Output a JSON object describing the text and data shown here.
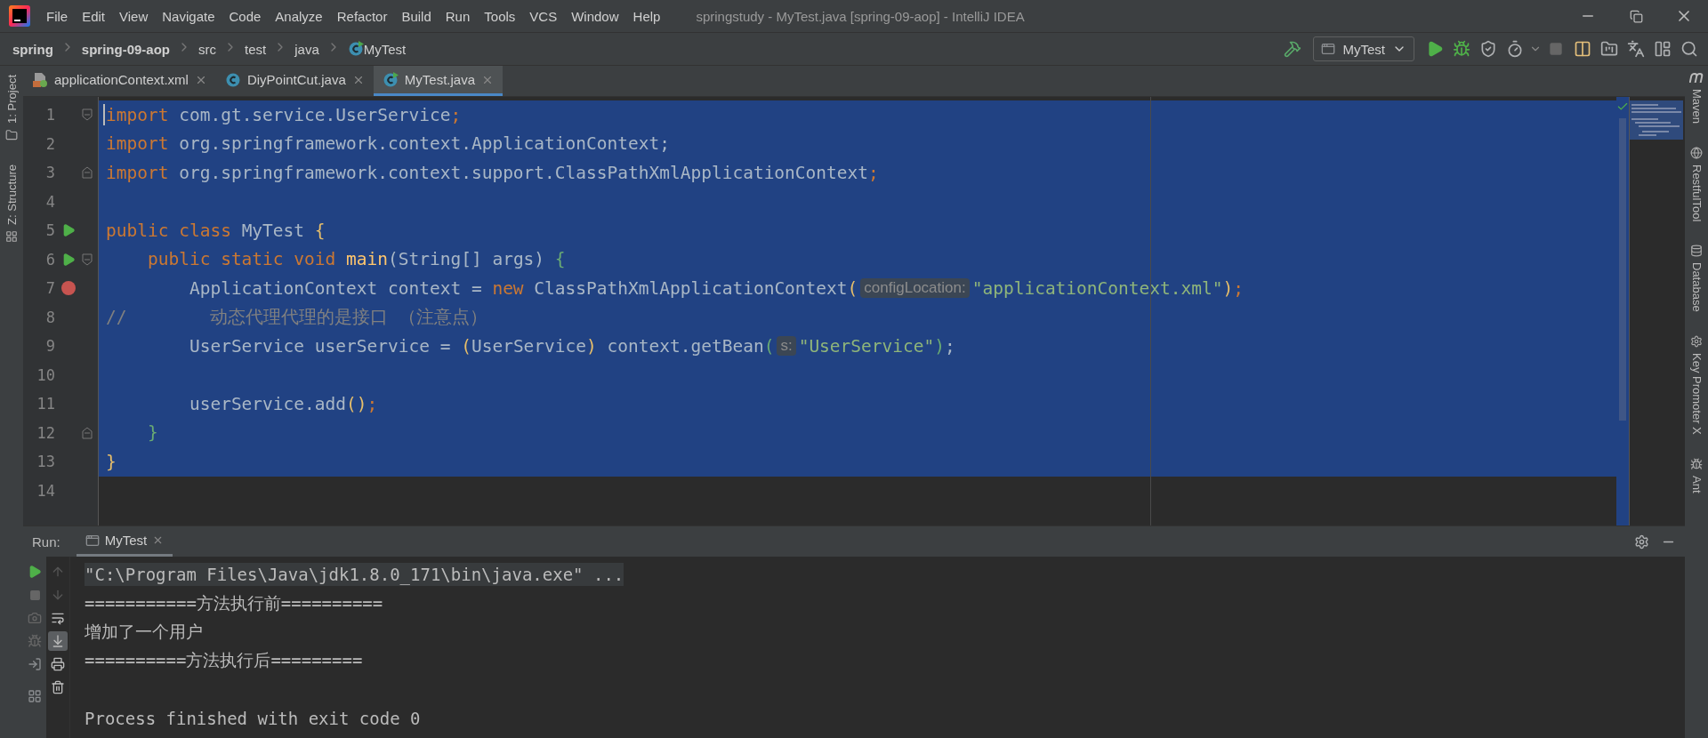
{
  "menu_bar": {
    "items": [
      "File",
      "Edit",
      "View",
      "Navigate",
      "Code",
      "Analyze",
      "Refactor",
      "Build",
      "Run",
      "Tools",
      "VCS",
      "Window",
      "Help"
    ],
    "title": "springstudy - MyTest.java [spring-09-aop] - IntelliJ IDEA"
  },
  "breadcrumbs": [
    {
      "label": "spring",
      "bold": true,
      "kind": "plain"
    },
    {
      "label": "spring-09-aop",
      "bold": true,
      "kind": "plain"
    },
    {
      "label": "src",
      "bold": false,
      "kind": "plain"
    },
    {
      "label": "test",
      "bold": false,
      "kind": "plain"
    },
    {
      "label": "java",
      "bold": false,
      "kind": "plain"
    },
    {
      "label": "MyTest",
      "bold": false,
      "kind": "class"
    }
  ],
  "toolbar": {
    "run_config": "MyTest"
  },
  "tabs": [
    {
      "label": "applicationContext.xml",
      "kind": "xml",
      "selected": false
    },
    {
      "label": "DiyPointCut.java",
      "kind": "java",
      "selected": false
    },
    {
      "label": "MyTest.java",
      "kind": "java",
      "selected": true
    }
  ],
  "left_tool_windows": [
    {
      "label": "1: Project",
      "kind": "project"
    },
    {
      "label": "Z: Structure",
      "kind": "structure"
    }
  ],
  "right_tool_windows": [
    {
      "label": "Maven",
      "kind": "maven"
    },
    {
      "label": "RestfulTool",
      "kind": "globe"
    },
    {
      "label": "Database",
      "kind": "database"
    },
    {
      "label": "Key Promoter X",
      "kind": "promoter"
    },
    {
      "label": "Ant",
      "kind": "ant"
    }
  ],
  "editor": {
    "lines": [
      {
        "number": "1",
        "selected": true,
        "run_marker": false,
        "breakpoint": false,
        "fold_start": true,
        "fold_end": false,
        "tokens": [
          {
            "kind": "keyword",
            "text": "import"
          },
          {
            "kind": "plain",
            "text": " com.gt.service.UserService"
          },
          {
            "kind": "keyword",
            "text": ";"
          }
        ]
      },
      {
        "number": "2",
        "selected": true,
        "run_marker": false,
        "breakpoint": false,
        "fold_start": false,
        "fold_end": false,
        "tokens": [
          {
            "kind": "keyword",
            "text": "import"
          },
          {
            "kind": "plain",
            "text": " org.springframework.context.ApplicationContext;"
          }
        ]
      },
      {
        "number": "3",
        "selected": true,
        "run_marker": false,
        "breakpoint": false,
        "fold_start": false,
        "fold_end": true,
        "tokens": [
          {
            "kind": "keyword",
            "text": "import"
          },
          {
            "kind": "plain",
            "text": " org.springframework.context.support.ClassPathXmlApplicationContext"
          },
          {
            "kind": "keyword",
            "text": ";"
          }
        ]
      },
      {
        "number": "4",
        "selected": true,
        "run_marker": false,
        "breakpoint": false,
        "fold_start": false,
        "fold_end": false
      },
      {
        "number": "5",
        "selected": true,
        "run_marker": true,
        "breakpoint": false,
        "fold_start": false,
        "fold_end": false,
        "tokens": [
          {
            "kind": "keyword",
            "text": "public class"
          },
          {
            "kind": "plain",
            "text": " MyTest "
          },
          {
            "kind": "bracket1",
            "text": "{"
          }
        ]
      },
      {
        "number": "6",
        "selected": true,
        "run_marker": true,
        "breakpoint": false,
        "fold_start": true,
        "fold_end": false,
        "tokens": [
          {
            "kind": "keyword",
            "text": "    public static void "
          },
          {
            "kind": "method",
            "text": "main"
          },
          {
            "kind": "plain",
            "text": "(String[] args) "
          },
          {
            "kind": "bracket2",
            "text": "{"
          }
        ]
      },
      {
        "number": "7",
        "selected": true,
        "run_marker": false,
        "breakpoint": true,
        "fold_start": false,
        "fold_end": false,
        "tokens": [
          {
            "kind": "plain",
            "text": "        ApplicationContext context = "
          },
          {
            "kind": "keyword",
            "text": "new"
          },
          {
            "kind": "plain",
            "text": " ClassPathXmlApplicationContext"
          },
          {
            "kind": "bracket1",
            "text": "("
          },
          {
            "kind": "hint",
            "text": "configLocation:"
          },
          {
            "kind": "string",
            "text": "\"applicationContext.xml\""
          },
          {
            "kind": "bracket1",
            "text": ")"
          },
          {
            "kind": "keyword",
            "text": ";"
          }
        ]
      },
      {
        "number": "8",
        "selected": true,
        "run_marker": false,
        "breakpoint": false,
        "fold_start": false,
        "fold_end": false,
        "tokens": [
          {
            "kind": "comment",
            "text": "//        动态代理代理的是接口 （注意点）"
          }
        ]
      },
      {
        "number": "9",
        "selected": true,
        "run_marker": false,
        "breakpoint": false,
        "fold_start": false,
        "fold_end": false,
        "tokens": [
          {
            "kind": "plain",
            "text": "        UserService userService = "
          },
          {
            "kind": "bracket1",
            "text": "("
          },
          {
            "kind": "plain",
            "text": "UserService"
          },
          {
            "kind": "bracket1",
            "text": ")"
          },
          {
            "kind": "plain",
            "text": " context.getBean"
          },
          {
            "kind": "bracket2",
            "text": "("
          },
          {
            "kind": "hint",
            "text": "s:"
          },
          {
            "kind": "string",
            "text": "\"UserService\""
          },
          {
            "kind": "bracket2",
            "text": ")"
          },
          {
            "kind": "plain",
            "text": ";"
          }
        ]
      },
      {
        "number": "10",
        "selected": true,
        "run_marker": false,
        "breakpoint": false,
        "fold_start": false,
        "fold_end": false
      },
      {
        "number": "11",
        "selected": true,
        "run_marker": false,
        "breakpoint": false,
        "fold_start": false,
        "fold_end": false,
        "tokens": [
          {
            "kind": "plain",
            "text": "        userService.add"
          },
          {
            "kind": "bracket1",
            "text": "()"
          },
          {
            "kind": "keyword",
            "text": ";"
          }
        ]
      },
      {
        "number": "12",
        "selected": true,
        "run_marker": false,
        "breakpoint": false,
        "fold_start": false,
        "fold_end": true,
        "tokens": [
          {
            "kind": "bracket2",
            "text": "    }"
          }
        ]
      },
      {
        "number": "13",
        "selected": true,
        "run_marker": false,
        "breakpoint": false,
        "fold_start": false,
        "fold_end": false,
        "tokens": [
          {
            "kind": "bracket1",
            "text": "}"
          }
        ]
      },
      {
        "number": "14",
        "selected": false,
        "run_marker": false,
        "breakpoint": false,
        "fold_start": false,
        "fold_end": false
      }
    ]
  },
  "run_panel": {
    "label": "Run:",
    "tabs": [
      {
        "label": "MyTest",
        "selected": true
      }
    ],
    "scroll_to_end": {
      "on": true
    },
    "console": [
      {
        "kind": "command",
        "text": "\"C:\\Program Files\\Java\\jdk1.8.0_171\\bin\\java.exe\" ..."
      },
      {
        "kind": "output",
        "text": "===========方法执行前=========="
      },
      {
        "kind": "output",
        "text": "增加了一个用户"
      },
      {
        "kind": "output",
        "text": "==========方法执行后========="
      },
      {
        "kind": "exit",
        "text": "Process finished with exit code 0"
      }
    ]
  }
}
